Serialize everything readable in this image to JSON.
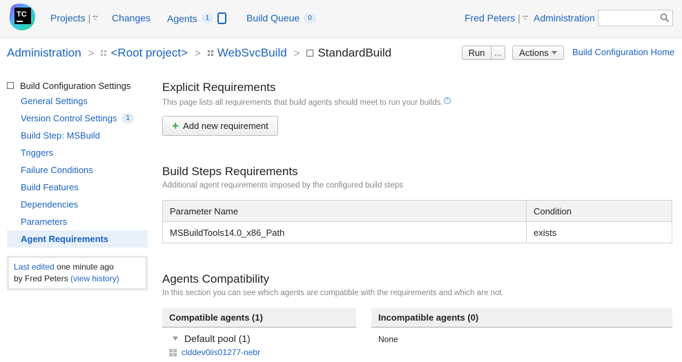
{
  "header": {
    "logo_text": "TC",
    "nav": {
      "projects": "Projects",
      "changes": "Changes",
      "agents": "Agents",
      "agents_count": "1",
      "build_queue": "Build Queue",
      "build_queue_count": "0"
    },
    "user": "Fred Peters",
    "administration": "Administration",
    "search_value": ""
  },
  "breadcrumb": {
    "items": [
      "Administration",
      "<Root project>",
      "WebSvcBuild"
    ],
    "current": "StandardBuild"
  },
  "toolbar": {
    "run_label": "Run",
    "run_more_label": "...",
    "actions_label": "Actions",
    "home_link": "Build Configuration Home"
  },
  "sidebar": {
    "title": "Build Configuration Settings",
    "items": [
      {
        "label": "General Settings"
      },
      {
        "label": "Version Control Settings",
        "badge": "1"
      },
      {
        "label": "Build Step: MSBuild"
      },
      {
        "label": "Triggers"
      },
      {
        "label": "Failure Conditions"
      },
      {
        "label": "Build Features"
      },
      {
        "label": "Dependencies"
      },
      {
        "label": "Parameters"
      },
      {
        "label": "Agent Requirements",
        "active": true
      }
    ],
    "last_edited": {
      "link": "Last edited",
      "time": " one minute ago",
      "by": "by Fred Peters ",
      "history_link": "(view history)"
    }
  },
  "explicit": {
    "title": "Explicit Requirements",
    "description": "This page lists all requirements that build agents should meet to run your builds.",
    "add_button": "Add new requirement"
  },
  "build_steps": {
    "title": "Build Steps Requirements",
    "description": "Additional agent requirements imposed by the configured build steps",
    "columns": [
      "Parameter Name",
      "Condition"
    ],
    "rows": [
      [
        "MSBuildTools14.0_x86_Path",
        "exists"
      ]
    ]
  },
  "compat": {
    "title": "Agents Compatibility",
    "description": "In this section you can see which agents are compatible with the requirements and which are not.",
    "compatible_header": "Compatible agents (1)",
    "incompatible_header": "Incompatible agents (0)",
    "pool": "Default pool (1)",
    "agent": "clddev0iis01277-nebr",
    "incompatible_value": "None"
  },
  "colors": {
    "link": "#1a63c2",
    "active_bg": "#e8f0fa",
    "plus": "#3ca83c"
  }
}
